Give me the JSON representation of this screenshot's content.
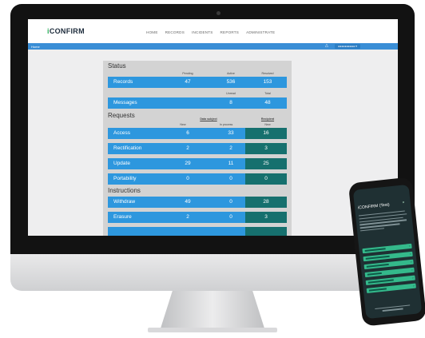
{
  "app": {
    "logo_prefix": "i",
    "logo_rest": "CONFIRM",
    "nav": [
      "HOME",
      "RECORDS",
      "INCIDENTS",
      "REPORTS",
      "ADMINISTRATE"
    ],
    "breadcrumb": "Home",
    "accent_blue": "#2d97de",
    "accent_teal": "#16706e",
    "brand_green": "#2db05d"
  },
  "status": {
    "title": "Status",
    "headers": [
      "Pending",
      "Active",
      "Resolved"
    ],
    "records": {
      "label": "Records",
      "values": [
        "47",
        "536",
        "153"
      ]
    },
    "messages_headers": [
      "Unread",
      "Total"
    ],
    "messages": {
      "label": "Messages",
      "values": [
        "8",
        "48"
      ]
    }
  },
  "requests": {
    "title": "Requests",
    "group_left": "Data subject",
    "group_right": "Recipient",
    "headers": [
      "New",
      "In process",
      "New"
    ],
    "rows": [
      {
        "label": "Access",
        "values": [
          "6",
          "33",
          "16"
        ]
      },
      {
        "label": "Rectification",
        "values": [
          "2",
          "2",
          "3"
        ]
      },
      {
        "label": "Update",
        "values": [
          "29",
          "11",
          "25"
        ]
      },
      {
        "label": "Portability",
        "values": [
          "0",
          "0",
          "0"
        ]
      }
    ]
  },
  "instructions": {
    "title": "Instructions",
    "rows": [
      {
        "label": "Withdraw",
        "values": [
          "49",
          "0",
          "28"
        ]
      },
      {
        "label": "Erasure",
        "values": [
          "2",
          "0",
          "3"
        ]
      }
    ]
  },
  "phone": {
    "title": "iCONFIRM (Test)",
    "close": "×",
    "button_count": 7
  },
  "icons": {
    "bell": "bell-icon",
    "chevron": "chevron-right-icon"
  }
}
